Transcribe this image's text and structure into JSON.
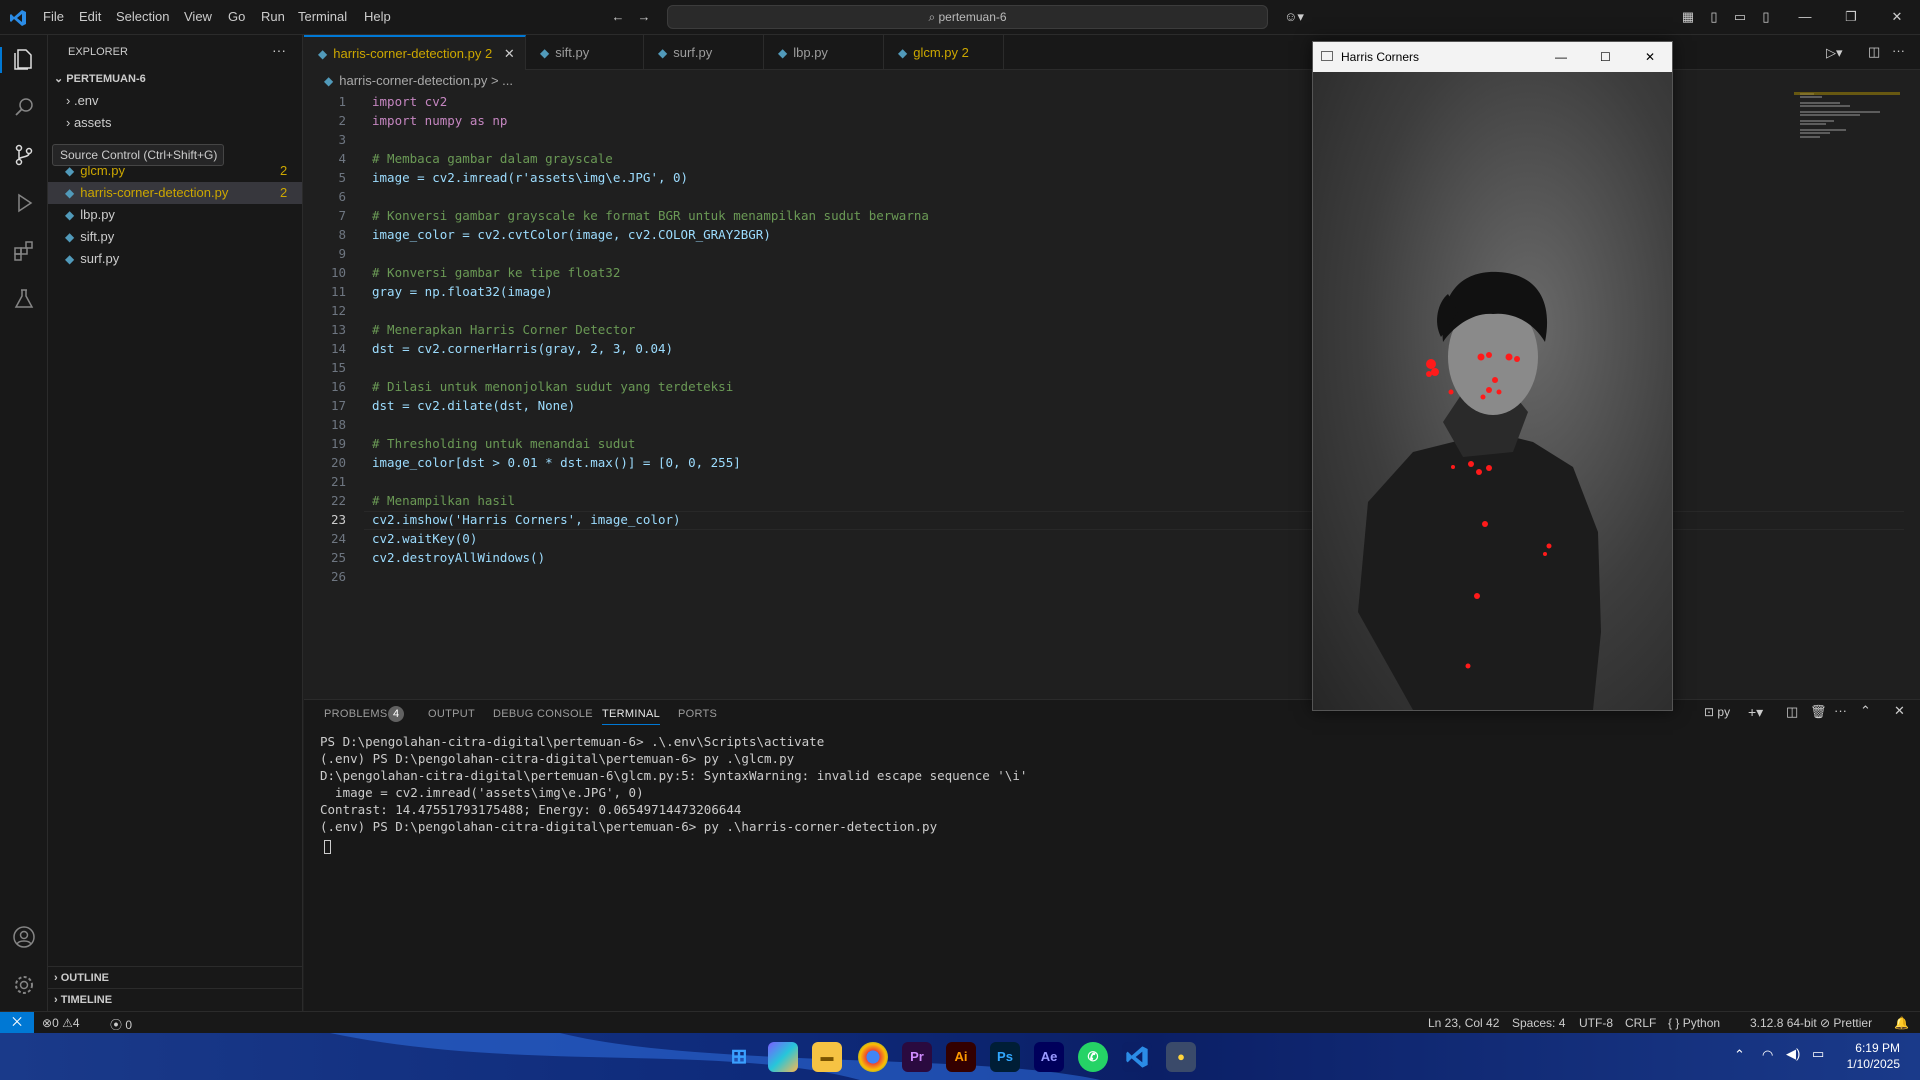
{
  "menu": [
    "File",
    "Edit",
    "Selection",
    "View",
    "Go",
    "Run",
    "Terminal",
    "Help"
  ],
  "command_center": "pertemuan-6",
  "explorer": {
    "title": "EXPLORER",
    "project": "PERTEMUAN-6",
    "folders": [
      ".env",
      "assets"
    ],
    "files": [
      {
        "name": "glcm.py",
        "badge": "2"
      },
      {
        "name": "harris-corner-detection.py",
        "badge": "2"
      },
      {
        "name": "lbp.py",
        "badge": ""
      },
      {
        "name": "sift.py",
        "badge": ""
      },
      {
        "name": "surf.py",
        "badge": ""
      }
    ],
    "outline": "OUTLINE",
    "timeline": "TIMELINE"
  },
  "tooltip": "Source Control (Ctrl+Shift+G)",
  "tabs": [
    {
      "label": "harris-corner-detection.py",
      "badge": "2"
    },
    {
      "label": "sift.py",
      "badge": ""
    },
    {
      "label": "surf.py",
      "badge": ""
    },
    {
      "label": "lbp.py",
      "badge": ""
    },
    {
      "label": "glcm.py",
      "badge": "2"
    }
  ],
  "breadcrumb": "harris-corner-detection.py > ...",
  "code_lines": [
    "import cv2",
    "import numpy as np",
    "",
    "# Membaca gambar dalam grayscale",
    "image = cv2.imread(r'assets\\img\\e.JPG', 0)",
    "",
    "# Konversi gambar grayscale ke format BGR untuk menampilkan sudut berwarna",
    "image_color = cv2.cvtColor(image, cv2.COLOR_GRAY2BGR)",
    "",
    "# Konversi gambar ke tipe float32",
    "gray = np.float32(image)",
    "",
    "# Menerapkan Harris Corner Detector",
    "dst = cv2.cornerHarris(gray, 2, 3, 0.04)",
    "",
    "# Dilasi untuk menonjolkan sudut yang terdeteksi",
    "dst = cv2.dilate(dst, None)",
    "",
    "# Thresholding untuk menandai sudut",
    "image_color[dst > 0.01 * dst.max()] = [0, 0, 255]",
    "",
    "# Menampilkan hasil",
    "cv2.imshow('Harris Corners', image_color)",
    "cv2.waitKey(0)",
    "cv2.destroyAllWindows()",
    ""
  ],
  "panel": {
    "tabs": [
      "PROBLEMS",
      "OUTPUT",
      "DEBUG CONSOLE",
      "TERMINAL",
      "PORTS"
    ],
    "problems_count": "4",
    "terminal_label": "py",
    "terminal_lines": [
      "PS D:\\pengolahan-citra-digital\\pertemuan-6> .\\.env\\Scripts\\activate",
      "(.env) PS D:\\pengolahan-citra-digital\\pertemuan-6> py .\\glcm.py",
      "D:\\pengolahan-citra-digital\\pertemuan-6\\glcm.py:5: SyntaxWarning: invalid escape sequence '\\i'",
      "  image = cv2.imread('assets\\img\\e.JPG', 0)",
      "Contrast: 14.47551793175488; Energy: 0.06549714473206644",
      "(.env) PS D:\\pengolahan-citra-digital\\pertemuan-6> py .\\harris-corner-detection.py"
    ]
  },
  "harris_window": {
    "title": "Harris Corners"
  },
  "status": {
    "errors": "0",
    "warnings": "4",
    "ports": "0",
    "position": "Ln 23, Col 42",
    "spaces": "Spaces: 4",
    "encoding": "UTF-8",
    "eol": "CRLF",
    "language": "Python",
    "version": "3.12.8 64-bit",
    "formatter": "Prettier"
  },
  "taskbar": {
    "time": "6:19 PM",
    "date": "1/10/2025",
    "apps": [
      "Pr",
      "Ai",
      "Ps",
      "Ae"
    ]
  },
  "colors": {
    "accent": "#0078d4",
    "keyword": "#c586c0",
    "comment": "#6a9955",
    "string": "#ce9178",
    "function": "#dcdcaa",
    "number": "#b5cea8",
    "variable": "#9cdcfe",
    "warning": "#cca700"
  }
}
